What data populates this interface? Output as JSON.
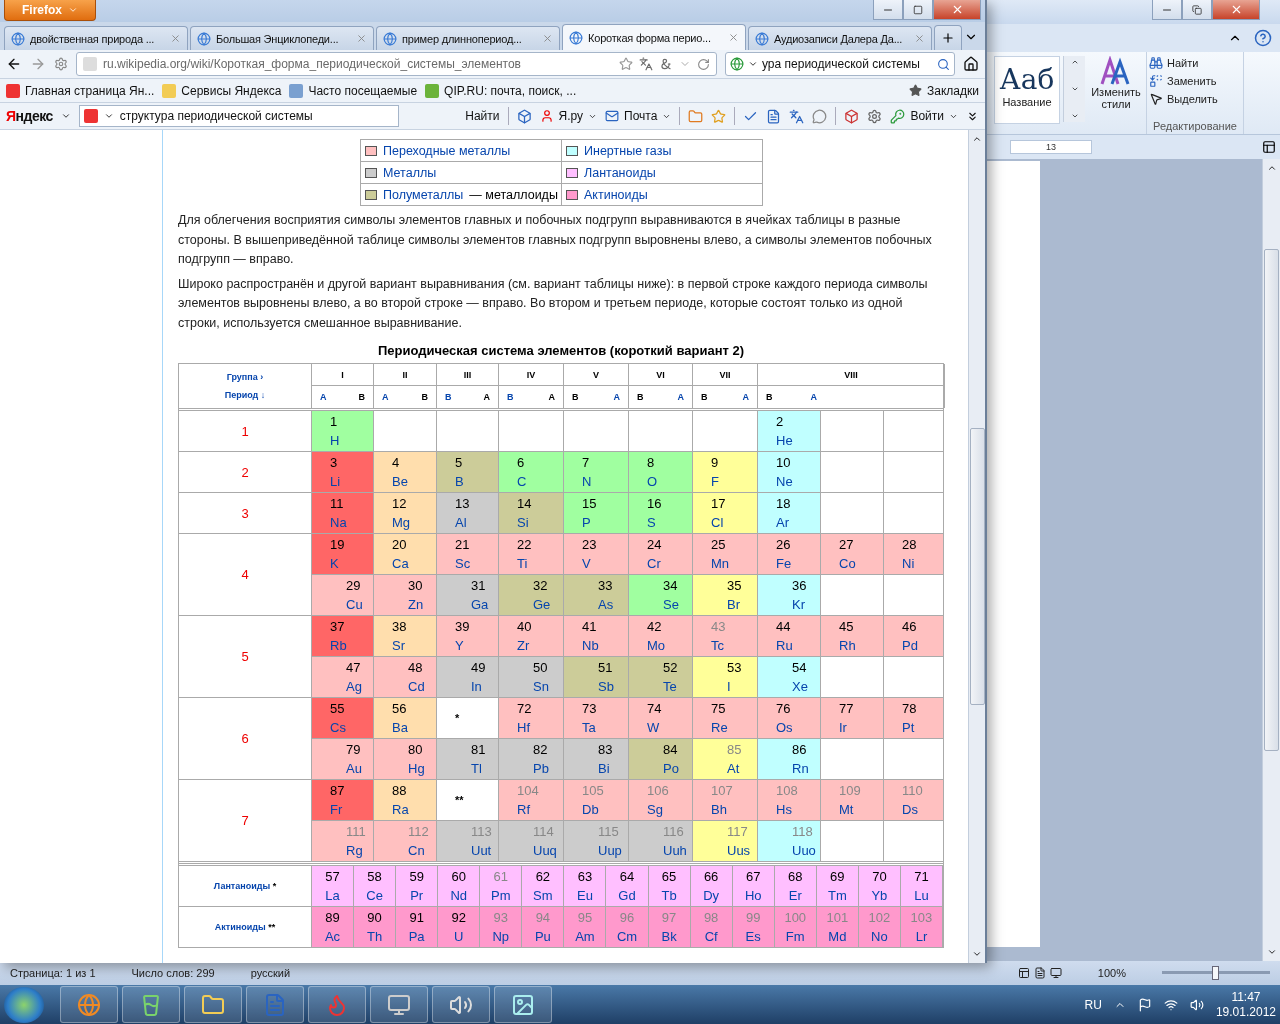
{
  "word": {
    "ribbon": {
      "style_sample": "Ааб",
      "style_name": "Название",
      "change_styles": "Изменить стили",
      "editing": [
        "Найти",
        "Заменить",
        "Выделить"
      ],
      "editing_group": "Редактирование"
    },
    "ruler_mark": "13",
    "status": [
      "Страница: 1 из 1",
      "Число слов: 299",
      "русский"
    ],
    "zoom": {
      "reading": "100%",
      "level": 0.5
    }
  },
  "firefox": {
    "menu_button": "Firefox",
    "tabs": [
      {
        "title": "двойственная природа ...",
        "selected": false
      },
      {
        "title": "Большая Энциклопеди...",
        "selected": false
      },
      {
        "title": "пример длиннопериод...",
        "selected": false
      },
      {
        "title": "Короткая форма перио...",
        "selected": true
      },
      {
        "title": "Аудиозаписи Далера Да...",
        "selected": false
      }
    ],
    "url": "ru.wikipedia.org/wiki/Короткая_форма_периодической_системы_элементов",
    "search": "ура периодической системы",
    "bookmarks": [
      "Главная страница Ян...",
      "Сервисы Яндекса",
      "Часто посещаемые",
      "QIP.RU: почта, поиск, ..."
    ],
    "bookmarks_menu": "Закладки",
    "yandex": {
      "logo": "Яндекс",
      "query": "структура периодической системы",
      "find": "Найти",
      "items": [
        "Я.ру",
        "Почта"
      ],
      "login": "Войти"
    }
  },
  "article": {
    "legend": [
      {
        "label": "Переходные металлы",
        "color": "#ffc0c0"
      },
      {
        "label": "Инертные газы",
        "color": "#c0ffff"
      },
      {
        "label": "Металлы",
        "color": "#cccccc"
      },
      {
        "label": "Лантаноиды",
        "color": "#ffbfff"
      },
      {
        "label": "Полуметаллы",
        "note": "— металлоиды",
        "color": "#cccc99"
      },
      {
        "label": "Актиноиды",
        "color": "#ff99cc"
      }
    ],
    "paragraphs": [
      "Для облегчения восприятия символы элементов главных и побочных подгрупп выравниваются в ячейках таблицы в разные стороны. В вышеприведённой таблице символы элементов главных подгрупп выровнены влево, а символы элементов побочных подгрупп — вправо.",
      "Широко распространён и другой вариант выравнивания (см. вариант таблицы ниже): в первой строке каждого периода символы элементов выровнены влево, а во второй строке — вправо. Во втором и третьем периоде, которые состоят только из одной строки, используется смешанное выравнивание."
    ],
    "table": {
      "caption": "Периодическая система элементов (короткий вариант 2)",
      "group_label": "Группа",
      "group_arrow": "›",
      "period_label": "Период",
      "period_arrow": "↓",
      "groups": [
        {
          "numeral": "I",
          "sub": [
            {
              "text": "A",
              "link": true
            },
            {
              "text": "B",
              "link": false
            }
          ]
        },
        {
          "numeral": "II",
          "sub": [
            {
              "text": "A",
              "link": true
            },
            {
              "text": "B",
              "link": false
            }
          ]
        },
        {
          "numeral": "III",
          "sub": [
            {
              "text": "B",
              "link": true
            },
            {
              "text": "A",
              "link": false
            }
          ]
        },
        {
          "numeral": "IV",
          "sub": [
            {
              "text": "B",
              "link": true
            },
            {
              "text": "A",
              "link": false
            }
          ]
        },
        {
          "numeral": "V",
          "sub": [
            {
              "text": "B",
              "link": false
            },
            {
              "text": "A",
              "link": true
            }
          ]
        },
        {
          "numeral": "VI",
          "sub": [
            {
              "text": "B",
              "link": false
            },
            {
              "text": "A",
              "link": true
            }
          ]
        },
        {
          "numeral": "VII",
          "sub": [
            {
              "text": "B",
              "link": false
            },
            {
              "text": "A",
              "link": true
            }
          ]
        },
        {
          "numeral": "VIII",
          "sub": [
            {
              "text": "B",
              "link": false
            },
            {
              "text": "A",
              "link": true
            }
          ]
        }
      ],
      "periods": [
        {
          "label": "1",
          "rows": [
            [
              {
                "kind": "element",
                "number": "1",
                "symbol": "H",
                "color": "#a0ffa0",
                "dim": false
              },
              {
                "kind": "empty"
              },
              {
                "kind": "empty"
              },
              {
                "kind": "empty"
              },
              {
                "kind": "empty"
              },
              {
                "kind": "empty"
              },
              {
                "kind": "empty"
              },
              {
                "kind": "element",
                "number": "2",
                "symbol": "He",
                "color": "#c0ffff",
                "dim": false
              },
              {
                "kind": "empty"
              },
              {
                "kind": "empty"
              }
            ]
          ]
        },
        {
          "label": "2",
          "rows": [
            [
              {
                "kind": "element",
                "number": "3",
                "symbol": "Li",
                "color": "#ff6666",
                "dim": false
              },
              {
                "kind": "element",
                "number": "4",
                "symbol": "Be",
                "color": "#ffdead",
                "dim": false
              },
              {
                "kind": "element",
                "number": "5",
                "symbol": "B",
                "color": "#cccc99",
                "dim": false
              },
              {
                "kind": "element",
                "number": "6",
                "symbol": "C",
                "color": "#a0ffa0",
                "dim": false
              },
              {
                "kind": "element",
                "number": "7",
                "symbol": "N",
                "color": "#a0ffa0",
                "dim": false
              },
              {
                "kind": "element",
                "number": "8",
                "symbol": "O",
                "color": "#a0ffa0",
                "dim": false
              },
              {
                "kind": "element",
                "number": "9",
                "symbol": "F",
                "color": "#ffff99",
                "dim": false
              },
              {
                "kind": "element",
                "number": "10",
                "symbol": "Ne",
                "color": "#c0ffff",
                "dim": false
              },
              {
                "kind": "empty"
              },
              {
                "kind": "empty"
              }
            ]
          ]
        },
        {
          "label": "3",
          "rows": [
            [
              {
                "kind": "element",
                "number": "11",
                "symbol": "Na",
                "color": "#ff6666",
                "dim": false
              },
              {
                "kind": "element",
                "number": "12",
                "symbol": "Mg",
                "color": "#ffdead",
                "dim": false
              },
              {
                "kind": "element",
                "number": "13",
                "symbol": "Al",
                "color": "#cccccc",
                "dim": false
              },
              {
                "kind": "element",
                "number": "14",
                "symbol": "Si",
                "color": "#cccc99",
                "dim": false
              },
              {
                "kind": "element",
                "number": "15",
                "symbol": "P",
                "color": "#a0ffa0",
                "dim": false
              },
              {
                "kind": "element",
                "number": "16",
                "symbol": "S",
                "color": "#a0ffa0",
                "dim": false
              },
              {
                "kind": "element",
                "number": "17",
                "symbol": "Cl",
                "color": "#ffff99",
                "dim": false
              },
              {
                "kind": "element",
                "number": "18",
                "symbol": "Ar",
                "color": "#c0ffff",
                "dim": false
              },
              {
                "kind": "empty"
              },
              {
                "kind": "empty"
              }
            ]
          ]
        },
        {
          "label": "4",
          "rows": [
            [
              {
                "kind": "element",
                "number": "19",
                "symbol": "K",
                "color": "#ff6666",
                "dim": false
              },
              {
                "kind": "element",
                "number": "20",
                "symbol": "Ca",
                "color": "#ffdead",
                "dim": false
              },
              {
                "kind": "element",
                "number": "21",
                "symbol": "Sc",
                "color": "#ffc0c0",
                "dim": false
              },
              {
                "kind": "element",
                "number": "22",
                "symbol": "Ti",
                "color": "#ffc0c0",
                "dim": false
              },
              {
                "kind": "element",
                "number": "23",
                "symbol": "V",
                "color": "#ffc0c0",
                "dim": false
              },
              {
                "kind": "element",
                "number": "24",
                "symbol": "Cr",
                "color": "#ffc0c0",
                "dim": false
              },
              {
                "kind": "element",
                "number": "25",
                "symbol": "Mn",
                "color": "#ffc0c0",
                "dim": false
              },
              {
                "kind": "element",
                "number": "26",
                "symbol": "Fe",
                "color": "#ffc0c0",
                "dim": false
              },
              {
                "kind": "element",
                "number": "27",
                "symbol": "Co",
                "color": "#ffc0c0",
                "dim": false
              },
              {
                "kind": "element",
                "number": "28",
                "symbol": "Ni",
                "color": "#ffc0c0",
                "dim": false
              }
            ],
            [
              {
                "kind": "element",
                "number": "29",
                "symbol": "Cu",
                "color": "#ffc0c0",
                "dim": false
              },
              {
                "kind": "element",
                "number": "30",
                "symbol": "Zn",
                "color": "#ffc0c0",
                "dim": false
              },
              {
                "kind": "element",
                "number": "31",
                "symbol": "Ga",
                "color": "#cccccc",
                "dim": false
              },
              {
                "kind": "element",
                "number": "32",
                "symbol": "Ge",
                "color": "#cccc99",
                "dim": false
              },
              {
                "kind": "element",
                "number": "33",
                "symbol": "As",
                "color": "#cccc99",
                "dim": false
              },
              {
                "kind": "element",
                "number": "34",
                "symbol": "Se",
                "color": "#a0ffa0",
                "dim": false
              },
              {
                "kind": "element",
                "number": "35",
                "symbol": "Br",
                "color": "#ffff99",
                "dim": false
              },
              {
                "kind": "element",
                "number": "36",
                "symbol": "Kr",
                "color": "#c0ffff",
                "dim": false
              },
              {
                "kind": "empty"
              },
              {
                "kind": "empty"
              }
            ]
          ]
        },
        {
          "label": "5",
          "rows": [
            [
              {
                "kind": "element",
                "number": "37",
                "symbol": "Rb",
                "color": "#ff6666",
                "dim": false
              },
              {
                "kind": "element",
                "number": "38",
                "symbol": "Sr",
                "color": "#ffdead",
                "dim": false
              },
              {
                "kind": "element",
                "number": "39",
                "symbol": "Y",
                "color": "#ffc0c0",
                "dim": false
              },
              {
                "kind": "element",
                "number": "40",
                "symbol": "Zr",
                "color": "#ffc0c0",
                "dim": false
              },
              {
                "kind": "element",
                "number": "41",
                "symbol": "Nb",
                "color": "#ffc0c0",
                "dim": false
              },
              {
                "kind": "element",
                "number": "42",
                "symbol": "Mo",
                "color": "#ffc0c0",
                "dim": false
              },
              {
                "kind": "element",
                "number": "43",
                "symbol": "Tc",
                "color": "#ffc0c0",
                "dim": true
              },
              {
                "kind": "element",
                "number": "44",
                "symbol": "Ru",
                "color": "#ffc0c0",
                "dim": false
              },
              {
                "kind": "element",
                "number": "45",
                "symbol": "Rh",
                "color": "#ffc0c0",
                "dim": false
              },
              {
                "kind": "element",
                "number": "46",
                "symbol": "Pd",
                "color": "#ffc0c0",
                "dim": false
              }
            ],
            [
              {
                "kind": "element",
                "number": "47",
                "symbol": "Ag",
                "color": "#ffc0c0",
                "dim": false
              },
              {
                "kind": "element",
                "number": "48",
                "symbol": "Cd",
                "color": "#ffc0c0",
                "dim": false
              },
              {
                "kind": "element",
                "number": "49",
                "symbol": "In",
                "color": "#cccccc",
                "dim": false
              },
              {
                "kind": "element",
                "number": "50",
                "symbol": "Sn",
                "color": "#cccccc",
                "dim": false
              },
              {
                "kind": "element",
                "number": "51",
                "symbol": "Sb",
                "color": "#cccc99",
                "dim": false
              },
              {
                "kind": "element",
                "number": "52",
                "symbol": "Te",
                "color": "#cccc99",
                "dim": false
              },
              {
                "kind": "element",
                "number": "53",
                "symbol": "I",
                "color": "#ffff99",
                "dim": false
              },
              {
                "kind": "element",
                "number": "54",
                "symbol": "Xe",
                "color": "#c0ffff",
                "dim": false
              },
              {
                "kind": "empty"
              },
              {
                "kind": "empty"
              }
            ]
          ]
        },
        {
          "label": "6",
          "rows": [
            [
              {
                "kind": "element",
                "number": "55",
                "symbol": "Cs",
                "color": "#ff6666",
                "dim": false
              },
              {
                "kind": "element",
                "number": "56",
                "symbol": "Ba",
                "color": "#ffdead",
                "dim": false
              },
              {
                "kind": "marker",
                "text": "*"
              },
              {
                "kind": "element",
                "number": "72",
                "symbol": "Hf",
                "color": "#ffc0c0",
                "dim": false
              },
              {
                "kind": "element",
                "number": "73",
                "symbol": "Ta",
                "color": "#ffc0c0",
                "dim": false
              },
              {
                "kind": "element",
                "number": "74",
                "symbol": "W",
                "color": "#ffc0c0",
                "dim": false
              },
              {
                "kind": "element",
                "number": "75",
                "symbol": "Re",
                "color": "#ffc0c0",
                "dim": false
              },
              {
                "kind": "element",
                "number": "76",
                "symbol": "Os",
                "color": "#ffc0c0",
                "dim": false
              },
              {
                "kind": "element",
                "number": "77",
                "symbol": "Ir",
                "color": "#ffc0c0",
                "dim": false
              },
              {
                "kind": "element",
                "number": "78",
                "symbol": "Pt",
                "color": "#ffc0c0",
                "dim": false
              }
            ],
            [
              {
                "kind": "element",
                "number": "79",
                "symbol": "Au",
                "color": "#ffc0c0",
                "dim": false
              },
              {
                "kind": "element",
                "number": "80",
                "symbol": "Hg",
                "color": "#ffc0c0",
                "dim": false
              },
              {
                "kind": "element",
                "number": "81",
                "symbol": "Tl",
                "color": "#cccccc",
                "dim": false
              },
              {
                "kind": "element",
                "number": "82",
                "symbol": "Pb",
                "color": "#cccccc",
                "dim": false
              },
              {
                "kind": "element",
                "number": "83",
                "symbol": "Bi",
                "color": "#cccccc",
                "dim": false
              },
              {
                "kind": "element",
                "number": "84",
                "symbol": "Po",
                "color": "#cccc99",
                "dim": false
              },
              {
                "kind": "element",
                "number": "85",
                "symbol": "At",
                "color": "#ffff99",
                "dim": true
              },
              {
                "kind": "element",
                "number": "86",
                "symbol": "Rn",
                "color": "#c0ffff",
                "dim": false
              },
              {
                "kind": "empty"
              },
              {
                "kind": "empty"
              }
            ]
          ]
        },
        {
          "label": "7",
          "rows": [
            [
              {
                "kind": "element",
                "number": "87",
                "symbol": "Fr",
                "color": "#ff6666",
                "dim": false
              },
              {
                "kind": "element",
                "number": "88",
                "symbol": "Ra",
                "color": "#ffdead",
                "dim": false
              },
              {
                "kind": "marker",
                "text": "**"
              },
              {
                "kind": "element",
                "number": "104",
                "symbol": "Rf",
                "color": "#ffc0c0",
                "dim": true
              },
              {
                "kind": "element",
                "number": "105",
                "symbol": "Db",
                "color": "#ffc0c0",
                "dim": true
              },
              {
                "kind": "element",
                "number": "106",
                "symbol": "Sg",
                "color": "#ffc0c0",
                "dim": true
              },
              {
                "kind": "element",
                "number": "107",
                "symbol": "Bh",
                "color": "#ffc0c0",
                "dim": true
              },
              {
                "kind": "element",
                "number": "108",
                "symbol": "Hs",
                "color": "#ffc0c0",
                "dim": true
              },
              {
                "kind": "element",
                "number": "109",
                "symbol": "Mt",
                "color": "#ffc0c0",
                "dim": true
              },
              {
                "kind": "element",
                "number": "110",
                "symbol": "Ds",
                "color": "#ffc0c0",
                "dim": true
              }
            ],
            [
              {
                "kind": "element",
                "number": "111",
                "symbol": "Rg",
                "color": "#ffc0c0",
                "dim": true
              },
              {
                "kind": "element",
                "number": "112",
                "symbol": "Cn",
                "color": "#ffc0c0",
                "dim": true
              },
              {
                "kind": "element",
                "number": "113",
                "symbol": "Uut",
                "color": "#cccccc",
                "dim": true
              },
              {
                "kind": "element",
                "number": "114",
                "symbol": "Uuq",
                "color": "#cccccc",
                "dim": true
              },
              {
                "kind": "element",
                "number": "115",
                "symbol": "Uup",
                "color": "#cccccc",
                "dim": true
              },
              {
                "kind": "element",
                "number": "116",
                "symbol": "Uuh",
                "color": "#cccccc",
                "dim": true
              },
              {
                "kind": "element",
                "number": "117",
                "symbol": "Uus",
                "color": "#ffff99",
                "dim": true
              },
              {
                "kind": "element",
                "number": "118",
                "symbol": "Uuo",
                "color": "#c0ffff",
                "dim": true
              },
              {
                "kind": "empty"
              },
              {
                "kind": "empty"
              }
            ]
          ]
        }
      ],
      "series": [
        {
          "label": "Лантаноиды",
          "mark": "*",
          "cells": [
            {
              "number": "57",
              "symbol": "La",
              "color": "#ffbfff",
              "dim": false
            },
            {
              "number": "58",
              "symbol": "Ce",
              "color": "#ffbfff",
              "dim": false
            },
            {
              "number": "59",
              "symbol": "Pr",
              "color": "#ffbfff",
              "dim": false
            },
            {
              "number": "60",
              "symbol": "Nd",
              "color": "#ffbfff",
              "dim": false
            },
            {
              "number": "61",
              "symbol": "Pm",
              "color": "#ffbfff",
              "dim": true
            },
            {
              "number": "62",
              "symbol": "Sm",
              "color": "#ffbfff",
              "dim": false
            },
            {
              "number": "63",
              "symbol": "Eu",
              "color": "#ffbfff",
              "dim": false
            },
            {
              "number": "64",
              "symbol": "Gd",
              "color": "#ffbfff",
              "dim": false
            },
            {
              "number": "65",
              "symbol": "Tb",
              "color": "#ffbfff",
              "dim": false
            },
            {
              "number": "66",
              "symbol": "Dy",
              "color": "#ffbfff",
              "dim": false
            },
            {
              "number": "67",
              "symbol": "Ho",
              "color": "#ffbfff",
              "dim": false
            },
            {
              "number": "68",
              "symbol": "Er",
              "color": "#ffbfff",
              "dim": false
            },
            {
              "number": "69",
              "symbol": "Tm",
              "color": "#ffbfff",
              "dim": false
            },
            {
              "number": "70",
              "symbol": "Yb",
              "color": "#ffbfff",
              "dim": false
            },
            {
              "number": "71",
              "symbol": "Lu",
              "color": "#ffbfff",
              "dim": false
            }
          ]
        },
        {
          "label": "Актиноиды",
          "mark": "**",
          "cells": [
            {
              "number": "89",
              "symbol": "Ac",
              "color": "#ff99cc",
              "dim": false
            },
            {
              "number": "90",
              "symbol": "Th",
              "color": "#ff99cc",
              "dim": false
            },
            {
              "number": "91",
              "symbol": "Pa",
              "color": "#ff99cc",
              "dim": false
            },
            {
              "number": "92",
              "symbol": "U",
              "color": "#ff99cc",
              "dim": false
            },
            {
              "number": "93",
              "symbol": "Np",
              "color": "#ff99cc",
              "dim": true
            },
            {
              "number": "94",
              "symbol": "Pu",
              "color": "#ff99cc",
              "dim": true
            },
            {
              "number": "95",
              "symbol": "Am",
              "color": "#ff99cc",
              "dim": true
            },
            {
              "number": "96",
              "symbol": "Cm",
              "color": "#ff99cc",
              "dim": true
            },
            {
              "number": "97",
              "symbol": "Bk",
              "color": "#ff99cc",
              "dim": true
            },
            {
              "number": "98",
              "symbol": "Cf",
              "color": "#ff99cc",
              "dim": true
            },
            {
              "number": "99",
              "symbol": "Es",
              "color": "#ff99cc",
              "dim": true
            },
            {
              "number": "100",
              "symbol": "Fm",
              "color": "#ff99cc",
              "dim": true
            },
            {
              "number": "101",
              "symbol": "Md",
              "color": "#ff99cc",
              "dim": true
            },
            {
              "number": "102",
              "symbol": "No",
              "color": "#ff99cc",
              "dim": true
            },
            {
              "number": "103",
              "symbol": "Lr",
              "color": "#ff99cc",
              "dim": true
            }
          ]
        }
      ]
    }
  },
  "taskbar": {
    "language": "RU",
    "time": "11:47",
    "date": "19.01.2012"
  }
}
